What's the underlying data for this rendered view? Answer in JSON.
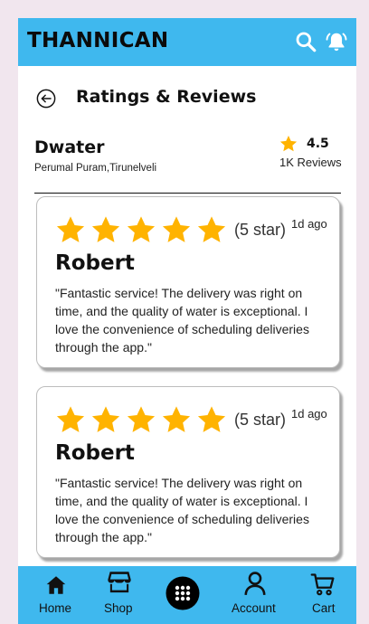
{
  "app": {
    "title": "THANNICAN"
  },
  "header": {
    "title": "Ratings & Reviews"
  },
  "vendor": {
    "name": "Dwater",
    "address": "Perumal Puram,Tirunelveli",
    "rating": "4.5",
    "review_count": "1K Reviews"
  },
  "reviews": [
    {
      "rating": 5,
      "star_label": "(5 star)",
      "time_ago": "1d ago",
      "name": "Robert",
      "text": "\"Fantastic service! The delivery was right on time, and the quality of water is exceptional. I love the convenience of scheduling deliveries through the app.\""
    },
    {
      "rating": 5,
      "star_label": "(5 star)",
      "time_ago": "1d ago",
      "name": "Robert",
      "text": "\"Fantastic service! The delivery was right on time, and the quality of water is exceptional. I love the convenience of scheduling deliveries through the app.\""
    }
  ],
  "nav": {
    "home": "Home",
    "shop": "Shop",
    "account": "Account",
    "cart": "Cart"
  },
  "icons": {
    "search": "search-icon",
    "bell": "bell-icon",
    "back": "back-arrow-icon",
    "star": "star-icon",
    "home": "home-icon",
    "shop": "shop-icon",
    "menu": "grid-menu-icon",
    "account": "account-icon",
    "cart": "cart-icon"
  },
  "colors": {
    "primary": "#3fb8ee",
    "star": "#ffb300",
    "background": "#f1e6ee"
  }
}
